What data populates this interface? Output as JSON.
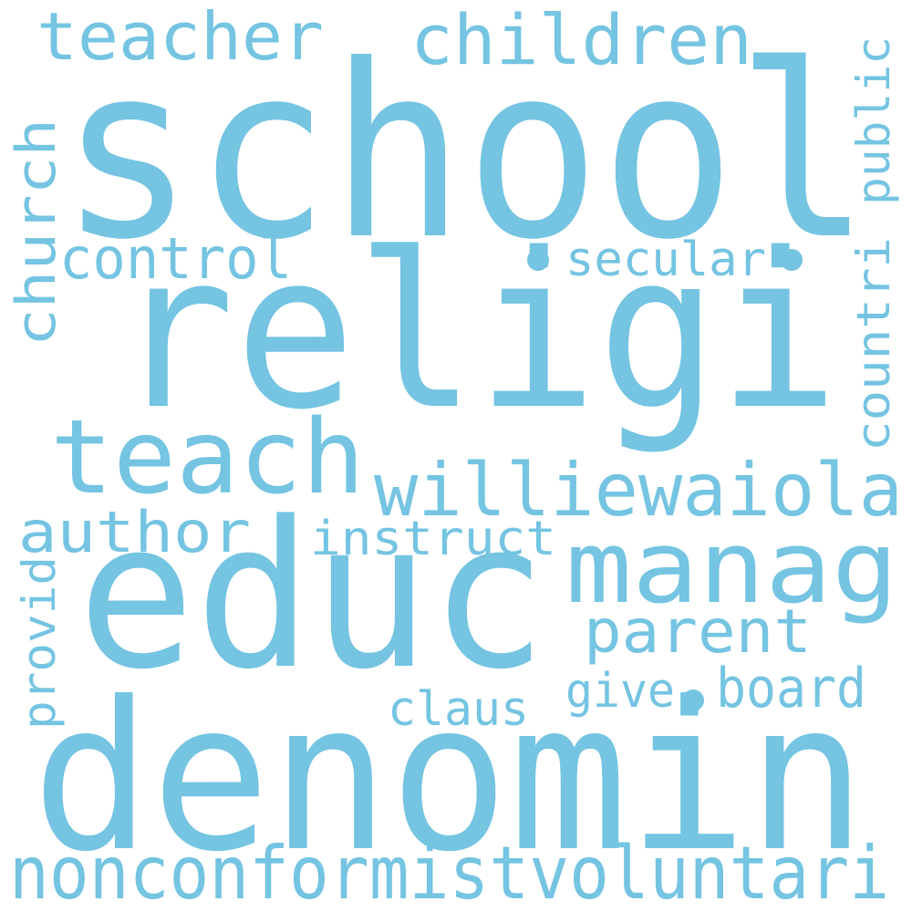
{
  "color": "#74C4E2",
  "words": [
    {
      "text": "school"
    },
    {
      "text": "religi"
    },
    {
      "text": "educ"
    },
    {
      "text": "denomin"
    },
    {
      "text": "teach"
    },
    {
      "text": "manag"
    },
    {
      "text": "williewaiola"
    },
    {
      "text": "nonconformistvoluntari"
    },
    {
      "text": "children"
    },
    {
      "text": "teacher"
    },
    {
      "text": "church"
    },
    {
      "text": "control"
    },
    {
      "text": "secular"
    },
    {
      "text": "public"
    },
    {
      "text": "countri"
    },
    {
      "text": "author"
    },
    {
      "text": "instruct"
    },
    {
      "text": "parent"
    },
    {
      "text": "provid"
    },
    {
      "text": "claus"
    },
    {
      "text": "give"
    },
    {
      "text": "board"
    }
  ],
  "dots": 3
}
